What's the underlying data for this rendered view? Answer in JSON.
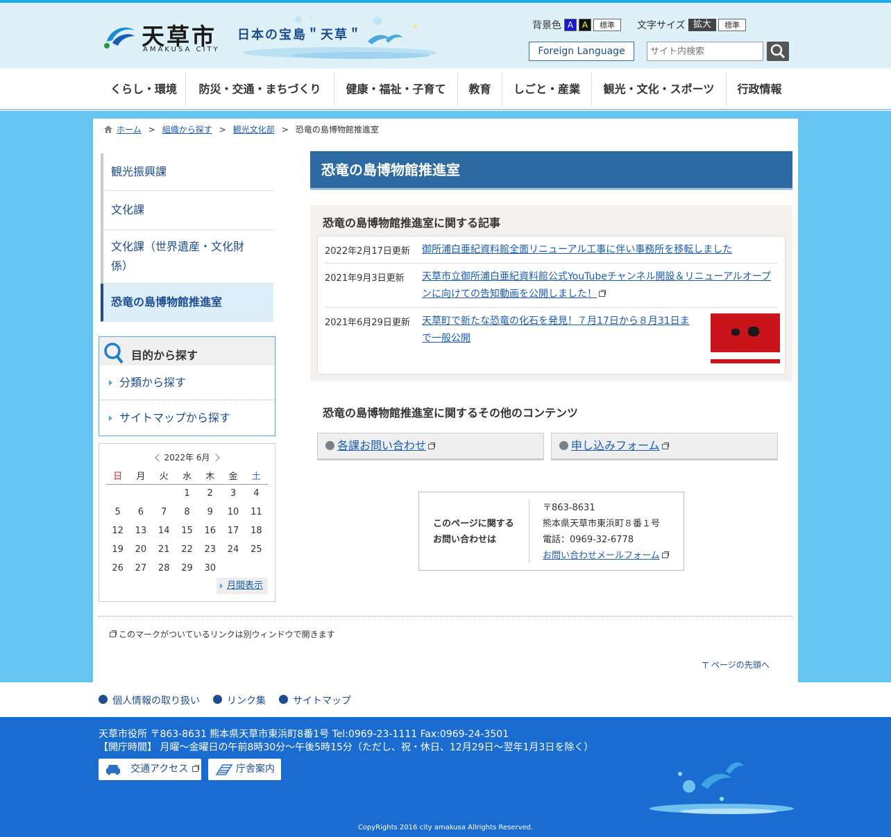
{
  "header": {
    "logo_name": "天草市",
    "logo_sub": "AMAKUSA CITY",
    "tagline": "日本の宝島＂天草＂",
    "bgcolor_label": "背景色",
    "bg_a1": "A",
    "bg_a2": "A",
    "bg_std": "標準",
    "fontsize_label": "文字サイズ",
    "fs_large": "拡大",
    "fs_std": "標準",
    "foreign_language": "Foreign Language",
    "search_placeholder": "サイト内検索"
  },
  "gnav": [
    "くらし・環境",
    "防災・交通・まちづくり",
    "健康・福祉・子育て",
    "教育",
    "しごと・産業",
    "観光・文化・スポーツ",
    "行政情報"
  ],
  "breadcrumb": {
    "home": "ホーム",
    "sep": ">",
    "level1": "組織から探す",
    "level2": "観光文化部",
    "current": "恐竜の島博物館推進室"
  },
  "sidebar": {
    "items": [
      "観光振興課",
      "文化課",
      "文化課（世界遺産・文化財係）",
      "恐竜の島博物館推進室"
    ]
  },
  "purpose": {
    "title": "目的から探す",
    "links": [
      "分類から探す",
      "サイトマップから探す"
    ]
  },
  "calendar": {
    "title": "2022年 6月",
    "weekdays": [
      "日",
      "月",
      "火",
      "水",
      "木",
      "金",
      "土"
    ],
    "weeks": [
      [
        "",
        "",
        "",
        "1",
        "2",
        "3",
        "4"
      ],
      [
        "5",
        "6",
        "7",
        "8",
        "9",
        "10",
        "11"
      ],
      [
        "12",
        "13",
        "14",
        "15",
        "16",
        "17",
        "18"
      ],
      [
        "19",
        "20",
        "21",
        "22",
        "23",
        "24",
        "25"
      ],
      [
        "26",
        "27",
        "28",
        "29",
        "30",
        "",
        ""
      ]
    ],
    "month_view": "月間表示",
    "sunday_color": "#d6202a",
    "saturday_color": "#2a6fc4"
  },
  "main": {
    "title": "恐竜の島博物館推進室",
    "articles_title": "恐竜の島博物館推進室に関する記事",
    "articles": [
      {
        "date": "2022年2月17日更新",
        "title": "御所浦白亜紀資料館全面リニューアル工事に伴い事務所を移転しました"
      },
      {
        "date": "2021年9月3日更新",
        "title": "天草市立御所浦白亜紀資料館公式YouTubeチャンネル開設＆リニューアルオープンに向けての告知動画を公開しました！"
      },
      {
        "date": "2021年6月29日更新",
        "title": "天草町で新たな恐竜の化石を発見！７月17日から８月31日まで一般公開"
      }
    ],
    "other_title": "恐竜の島博物館推進室に関するその他のコンテンツ",
    "other_links": [
      "各課お問い合わせ",
      "申し込みフォーム"
    ]
  },
  "contact": {
    "label_line1": "このページに関する",
    "label_line2": "お問い合わせは",
    "postal": "〒863-8631",
    "address": "熊本県天草市東浜町８番１号",
    "phone": "電話：0969-32-6778",
    "mail_form": "お問い合わせメールフォーム"
  },
  "notes": {
    "ext_note": "このマークがついているリンクは別ウィンドウで開きます",
    "to_top": "ページの先頭へ"
  },
  "footer_links": [
    "個人情報の取り扱い",
    "リンク集",
    "サイトマップ"
  ],
  "footer": {
    "address_line": "天草市役所 〒863-8631  熊本県天草市東浜町8番1号   Tel:0969-23-1111   Fax:0969-24-3501",
    "hours_line": "【開庁時間】 月曜～金曜日の午前8時30分～午後5時15分（ただし、祝・休日、12月29日～翌年1月3日を除く）",
    "access_btn": "交通アクセス",
    "building_btn": "庁舎案内",
    "copyright": "CopyRights 2016 city amakusa Allrights Reserved."
  },
  "colors": {
    "header_bg": "#dff1f8",
    "accent_blue": "#2d6aa2",
    "band_blue": "#66c5f0",
    "footer_blue": "#1a6cd0"
  }
}
